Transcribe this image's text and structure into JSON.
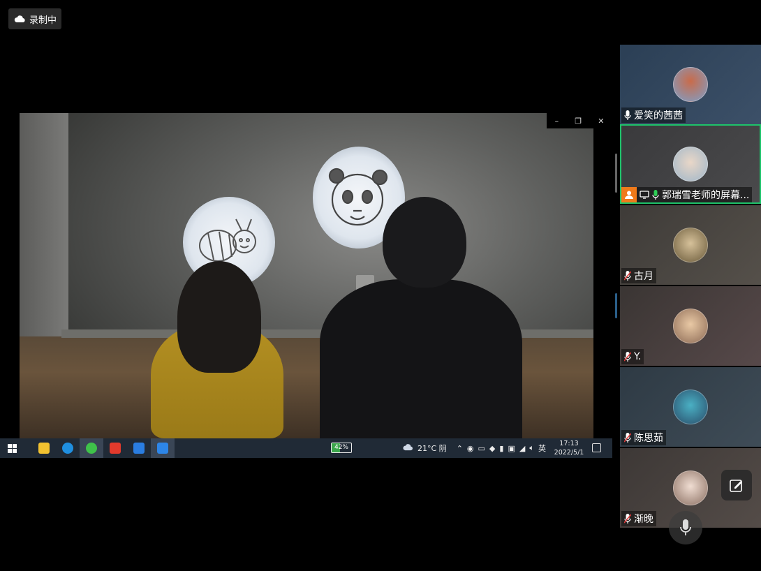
{
  "recording": {
    "label": "录制中"
  },
  "shared_screen": {
    "window_controls": {
      "minimize": "–",
      "restore": "❐",
      "close": "✕"
    },
    "taskbar": {
      "battery": "42%",
      "battery_level": 0.42,
      "weather": "21°C 阴",
      "ime": "英",
      "time": "17:13",
      "date": "2022/5/1"
    }
  },
  "participants": [
    {
      "name": "爱笑的茜茜",
      "mic": "on",
      "active": false
    },
    {
      "name": "郭瑞雪老师的屏幕...",
      "mic": "on",
      "active": true,
      "host": true,
      "sharing": true
    },
    {
      "name": "古月",
      "mic": "muted",
      "active": false
    },
    {
      "name": "Y.",
      "mic": "muted",
      "active": false
    },
    {
      "name": "陈思茹",
      "mic": "muted",
      "active": false
    },
    {
      "name": "渐晚",
      "mic": "muted",
      "active": false
    }
  ],
  "colors": {
    "active_border": "#1ec36a",
    "host_badge": "#f07a1a",
    "mute_red": "#e03b3b",
    "mic_on": "#ffffff",
    "mic_green": "#2ecc55"
  }
}
